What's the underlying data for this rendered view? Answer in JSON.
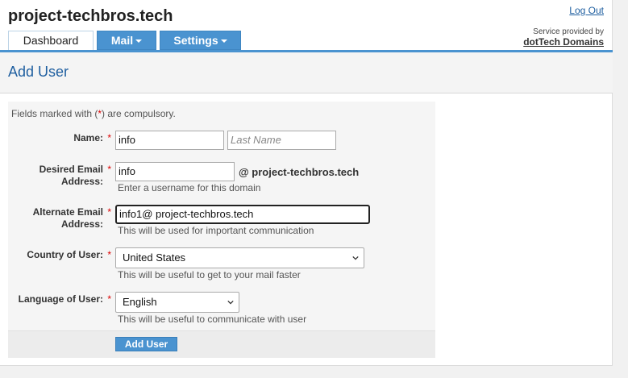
{
  "header": {
    "site_title": "project-techbros.tech",
    "logout_label": "Log Out",
    "service_line": "Service provided by",
    "service_brand": "dotTech Domains"
  },
  "tabs": [
    {
      "label": "Dashboard",
      "active": true
    },
    {
      "label": "Mail",
      "dropdown": true
    },
    {
      "label": "Settings",
      "dropdown": true
    }
  ],
  "page_title": "Add User",
  "form": {
    "note_prefix": "Fields marked with (",
    "note_star": "*",
    "note_suffix": ") are compulsory.",
    "required_mark": "*",
    "name": {
      "label": "Name:",
      "first_value": "info",
      "last_placeholder": "Last Name"
    },
    "desired_email": {
      "label_line1": "Desired Email",
      "label_line2": "Address:",
      "value": "info",
      "domain_suffix": "@ project-techbros.tech",
      "hint": "Enter a username for this domain"
    },
    "alternate_email": {
      "label_line1": "Alternate Email",
      "label_line2": "Address:",
      "value": "info1@ project-techbros.tech",
      "hint": "This will be used for important communication"
    },
    "country": {
      "label": "Country of User:",
      "selected": "United States",
      "hint": "This will be useful to get to your mail faster"
    },
    "language": {
      "label": "Language of User:",
      "selected": "English",
      "hint": "This will be useful to communicate with user"
    },
    "submit_label": "Add User"
  },
  "colors": {
    "accent": "#4a93d0",
    "link": "#1f5fa0",
    "required": "#dd0000"
  }
}
